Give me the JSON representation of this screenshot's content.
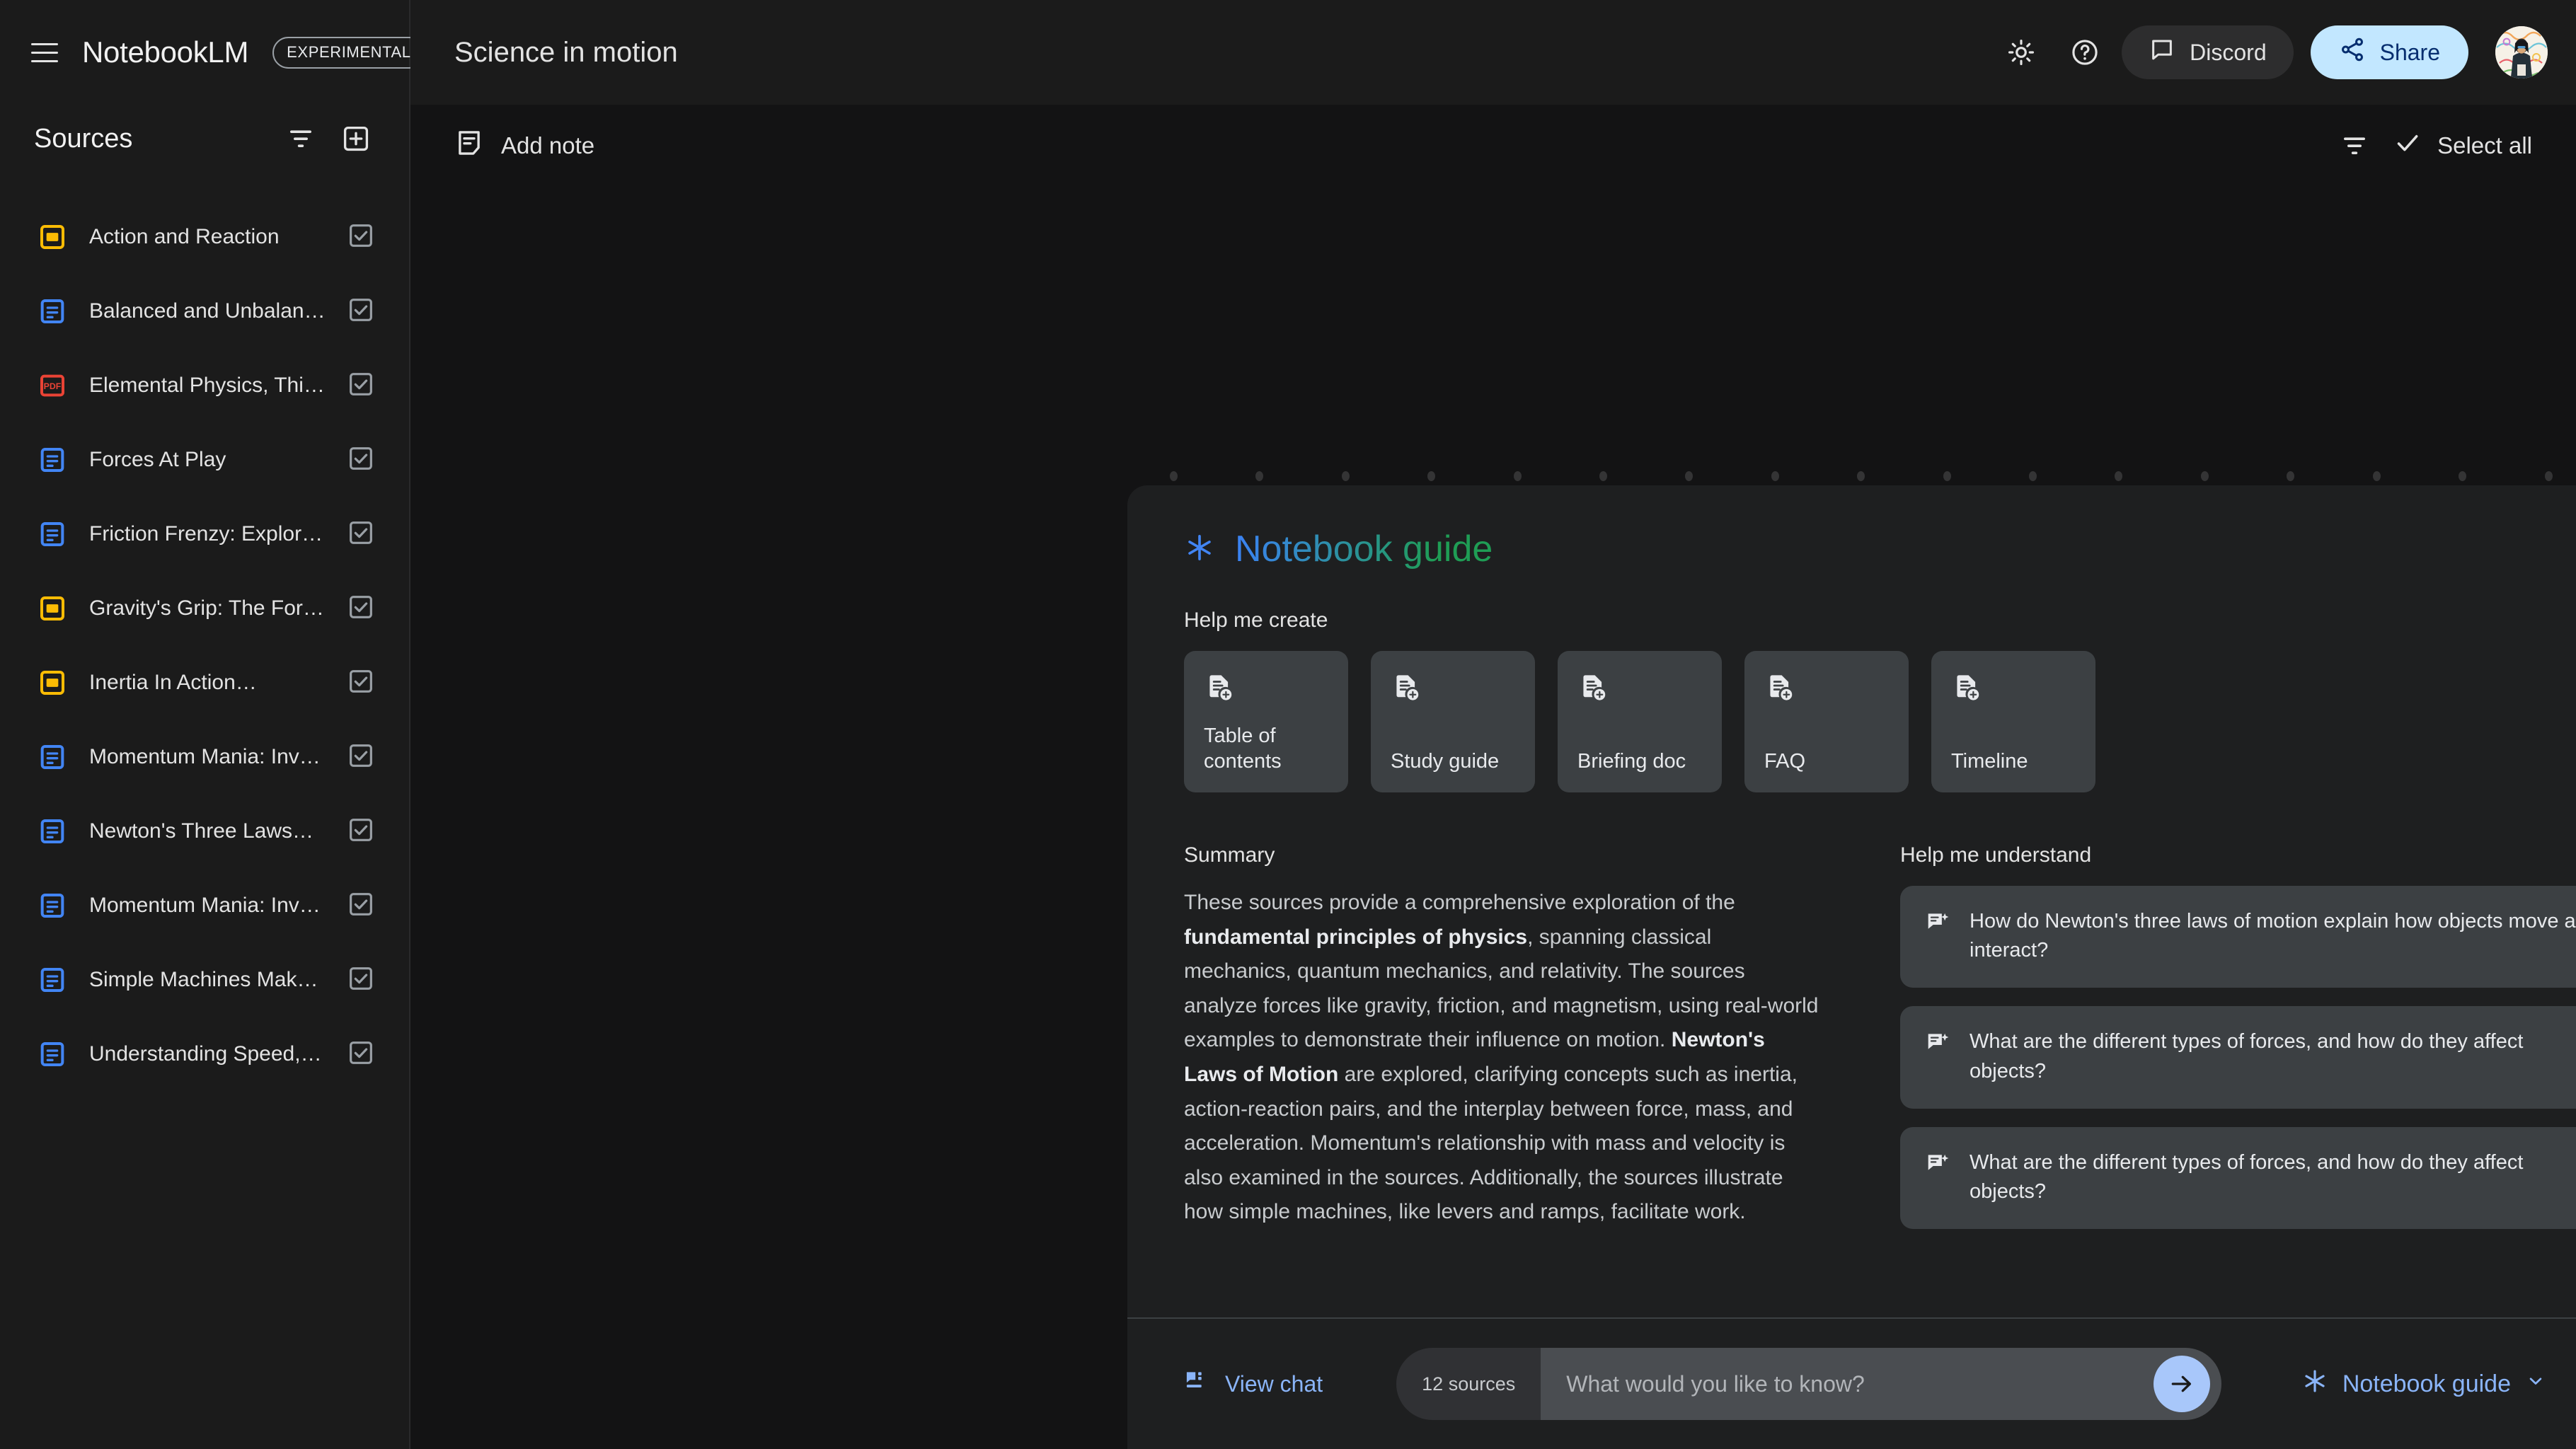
{
  "brand": {
    "name": "NotebookLM",
    "badge": "EXPERIMENTAL",
    "menu_icon": "hamburger-menu-icon"
  },
  "sidebar": {
    "sources_title": "Sources",
    "filter_icon": "filter-icon",
    "add_icon": "add-source-icon",
    "sources": [
      {
        "label": "Action and Reaction",
        "type": "slides",
        "checked": true
      },
      {
        "label": "Balanced and Unbalance…",
        "type": "doc",
        "checked": true
      },
      {
        "label": "Elemental Physics, Third…",
        "type": "pdf",
        "checked": true
      },
      {
        "label": "Forces At Play",
        "type": "doc",
        "checked": true
      },
      {
        "label": "Friction Frenzy: Explorin…",
        "type": "doc",
        "checked": true
      },
      {
        "label": "Gravity's Grip: The Force…",
        "type": "slides",
        "checked": true
      },
      {
        "label": "Inertia In Action…",
        "type": "slides",
        "checked": true
      },
      {
        "label": "Momentum Mania: Inves…",
        "type": "doc",
        "checked": true
      },
      {
        "label": "Newton's Three Laws…",
        "type": "doc",
        "checked": true
      },
      {
        "label": "Momentum Mania: Inves…",
        "type": "doc",
        "checked": true
      },
      {
        "label": "Simple Machines Make…",
        "type": "doc",
        "checked": true
      },
      {
        "label": "Understanding Speed, Ve…",
        "type": "doc",
        "checked": true
      }
    ]
  },
  "header": {
    "notebook_title": "Science in motion",
    "brightness_icon": "brightness-sun-icon",
    "help_icon": "help-circle-icon",
    "discord_label": "Discord",
    "discord_icon": "chat-bubble-icon",
    "share_label": "Share",
    "share_icon": "share-nodes-icon",
    "avatar_name": "user-avatar"
  },
  "toolbar": {
    "add_note_label": "Add note",
    "add_note_icon": "note-add-icon",
    "filter_icon": "filter-icon",
    "select_all_label": "Select all",
    "check_icon": "check-icon"
  },
  "guide": {
    "title": "Notebook guide",
    "title_icon": "asterisk-spark-icon",
    "create_label": "Help me create",
    "create_cards": [
      {
        "label": "Table of contents",
        "icon": "doc-add-icon"
      },
      {
        "label": "Study guide",
        "icon": "doc-add-icon"
      },
      {
        "label": "Briefing doc",
        "icon": "doc-add-icon"
      },
      {
        "label": "FAQ",
        "icon": "doc-add-icon"
      },
      {
        "label": "Timeline",
        "icon": "doc-add-icon"
      }
    ],
    "summary_label": "Summary",
    "summary_parts": [
      {
        "text": "These sources provide a comprehensive exploration of the ",
        "bold": false
      },
      {
        "text": "fundamental principles of physics",
        "bold": true
      },
      {
        "text": ", spanning classical mechanics, quantum mechanics, and relativity. The sources analyze forces like gravity, friction, and magnetism, using real-world examples to demonstrate their influence on motion. ",
        "bold": false
      },
      {
        "text": "Newton's Laws of Motion",
        "bold": true
      },
      {
        "text": " are explored, clarifying concepts such as inertia, action-reaction pairs, and the interplay between force, mass, and acceleration. Momentum's relationship with mass and velocity is also examined in the sources. Additionally, the sources illustrate how simple machines, like levers and ramps, facilitate work.",
        "bold": false
      }
    ],
    "understand_label": "Help me understand",
    "questions": [
      {
        "text": "How do Newton's three laws of motion explain how objects move and interact?",
        "icon": "doc-spark-icon"
      },
      {
        "text": "What are the different types of forces, and how do they affect objects?",
        "icon": "doc-spark-icon"
      },
      {
        "text": "What are the different types of forces, and how do they affect objects?",
        "icon": "doc-spark-icon"
      }
    ]
  },
  "bottom": {
    "view_chat_label": "View chat",
    "view_chat_icon": "chat-panel-icon",
    "sources_count_label": "12 sources",
    "input_value": "",
    "input_placeholder": "What would you like to know?",
    "send_icon": "arrow-right-icon",
    "guide_switch_label": "Notebook guide",
    "guide_switch_icon": "asterisk-spark-icon",
    "chevron_icon": "chevron-down-icon"
  },
  "colors": {
    "accent_blue": "#8ab4f8",
    "share_bg": "#c2e7ff",
    "card_bg": "#3c4043",
    "panel_bg": "#1e1f20",
    "page_bg": "#131314",
    "sidebar_bg": "#1b1b1b",
    "doc_icon": "#4285f4",
    "slides_icon": "#fbbc04",
    "pdf_icon": "#ea4335"
  }
}
